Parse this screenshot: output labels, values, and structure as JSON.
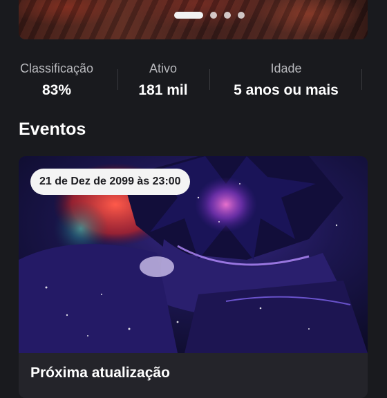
{
  "carousel": {
    "total": 4,
    "active_index": 0
  },
  "stats": [
    {
      "label": "Classificação",
      "value": "83%"
    },
    {
      "label": "Ativo",
      "value": "181 mil"
    },
    {
      "label": "Idade",
      "value": "5 anos ou mais"
    }
  ],
  "events": {
    "heading": "Eventos",
    "items": [
      {
        "date": "21 de Dez de 2099 às 23:00",
        "title": "Próxima atualização"
      }
    ]
  }
}
